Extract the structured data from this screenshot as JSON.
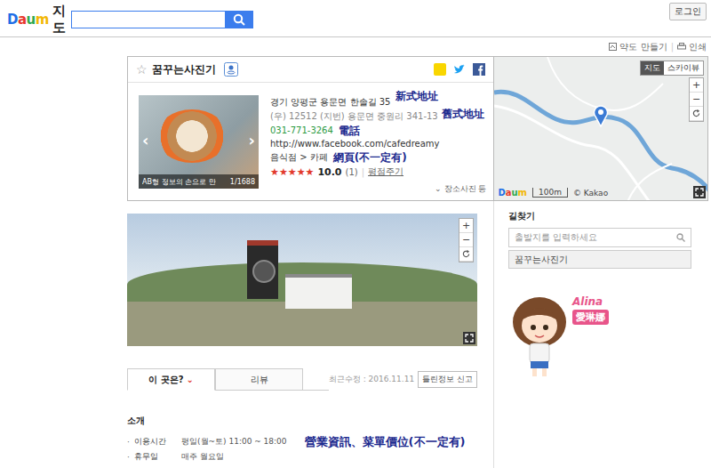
{
  "header": {
    "logo": "Daum",
    "title": "지도",
    "search": {
      "value": ""
    },
    "search_button": "",
    "login": "로그인"
  },
  "toolbar": [
    "약도 만들기",
    "인쇄"
  ],
  "place": {
    "name": "꿈꾸는사진기",
    "address": "경기 양평군 용문면 한솔길 35",
    "old_address": "(우) 12512 (지번) 용문면 중원리 341-13",
    "phone": "031-771-3264",
    "website": "http://www.facebook.com/cafedreamy",
    "category": "음식점 > 카페",
    "rating": {
      "stars": 5,
      "score": "10.0",
      "count": "(1)"
    },
    "rate_link": "평점주기",
    "photo": {
      "caption": "AB형 정보의 손으로 만",
      "counter": "1/1688",
      "prev": "‹",
      "next": "›"
    },
    "more": "장소사진 등"
  },
  "annotations": {
    "address": "新式地址",
    "old_address": "舊式地址",
    "phone": "電話",
    "website": "網頁(不一定有)",
    "hours": "營業資訊、菜單價位(不一定有)"
  },
  "map": {
    "modes": [
      {
        "label": "지도",
        "selected": true
      },
      {
        "label": "스카이뷰",
        "selected": false
      }
    ],
    "zoom": [
      "+",
      "−"
    ],
    "scale": "100m",
    "copyright": "© Kakao",
    "logo": "Daum"
  },
  "streetview": {
    "zoom": [
      "+",
      "−"
    ]
  },
  "directions": {
    "title": "길찾기",
    "placeholder": "출발지를 입력하세요",
    "destination": "꿈꾸는사진기"
  },
  "mascot": {
    "name": "Alina",
    "name_cn": "愛琳娜"
  },
  "tabs": [
    {
      "label": "이 곳은?",
      "selected": true
    },
    {
      "label": "리뷰",
      "selected": false
    }
  ],
  "updated": "최근수정 : 2016.11.11",
  "report": "틀린정보 신고",
  "intro": {
    "title": "소개",
    "bullet": "·",
    "rows": [
      {
        "label": "이용시간",
        "value": "평일(월~토) 11:00 ~ 18:00"
      },
      {
        "label": "휴무일",
        "value": "매주 월요일"
      }
    ]
  }
}
